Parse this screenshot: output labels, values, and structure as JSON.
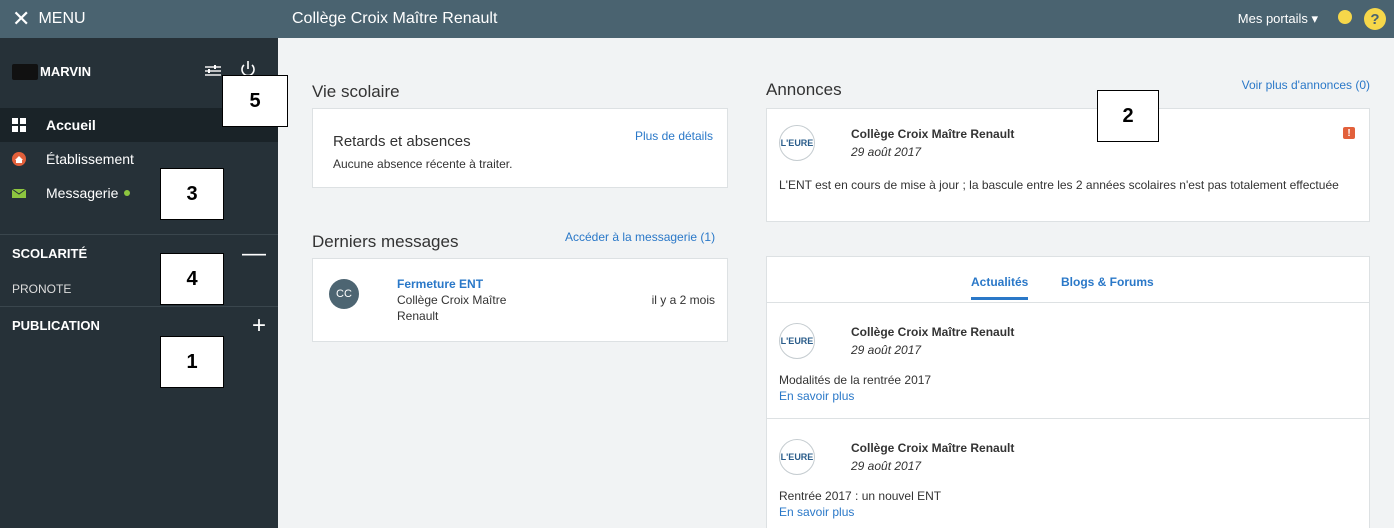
{
  "sidebar": {
    "menu_label": "MENU",
    "user_name": "MARVIN",
    "nav": [
      {
        "label": "Accueil"
      },
      {
        "label": "Établissement"
      },
      {
        "label": "Messagerie"
      }
    ],
    "sections": [
      {
        "label": "SCOLARITÉ",
        "sign": "—",
        "items": [
          "PRONOTE"
        ]
      },
      {
        "label": "PUBLICATION",
        "sign": "+"
      }
    ]
  },
  "annotations": {
    "box1": "1",
    "box2": "2",
    "box3": "3",
    "box4": "4",
    "box5": "5"
  },
  "header": {
    "title": "Collège Croix Maître Renault",
    "portails": "Mes portails",
    "help": "?"
  },
  "vie_scolaire": {
    "title": "Vie scolaire",
    "card_title": "Retards et absences",
    "details_link": "Plus de détails",
    "text": "Aucune absence récente à traiter."
  },
  "messages": {
    "title": "Derniers messages",
    "link": "Accéder à la messagerie (1)",
    "item": {
      "avatar": "CC",
      "subject": "Fermeture ENT",
      "from_line1": "Collège Croix Maître",
      "from_line2": "Renault",
      "time": "il y a 2 mois"
    }
  },
  "annonces": {
    "title": "Annonces",
    "link": "Voir plus d'annonces (0)",
    "item": {
      "logo": "L'EURE",
      "author": "Collège Croix Maître Renault",
      "date": "29 août 2017",
      "alert": "!",
      "text": "L'ENT est en cours de mise à jour ; la bascule entre les 2 années scolaires n'est pas totalement effectuée"
    }
  },
  "news": {
    "tabs": [
      "Actualités",
      "Blogs & Forums"
    ],
    "items": [
      {
        "logo": "L'EURE",
        "author": "Collège Croix Maître Renault",
        "date": "29 août 2017",
        "text": "Modalités de la rentrée 2017",
        "more": "En savoir plus"
      },
      {
        "logo": "L'EURE",
        "author": "Collège Croix Maître Renault",
        "date": "29 août 2017",
        "text": "Rentrée 2017 : un nouvel ENT",
        "more": "En savoir plus"
      }
    ]
  },
  "colors": {
    "sidebar": "#263138",
    "header": "#4a6370",
    "link": "#2a78c8",
    "alert": "#e2603b",
    "accent_dot": "#8dc63f"
  }
}
